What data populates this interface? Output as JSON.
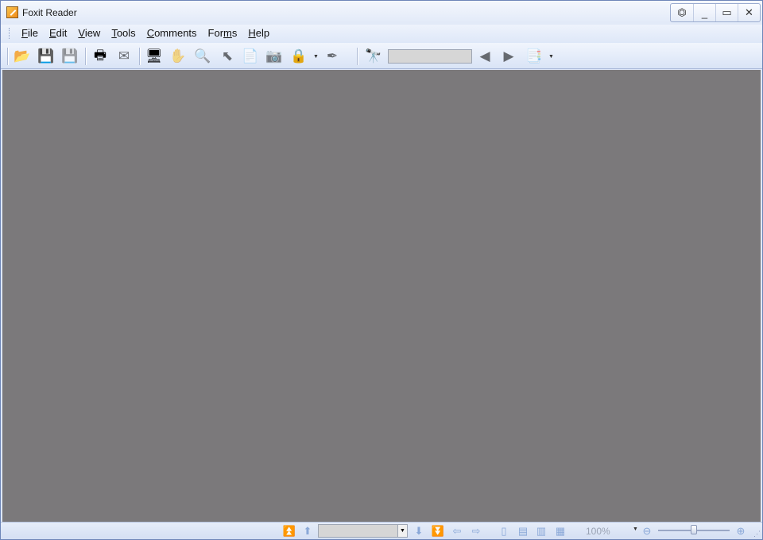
{
  "window": {
    "title": "Foxit Reader"
  },
  "menu": {
    "file": "File",
    "edit": "Edit",
    "view": "View",
    "tools": "Tools",
    "comments": "Comments",
    "forms": "Forms",
    "help": "Help"
  },
  "toolbar": {
    "find_value": ""
  },
  "statusbar": {
    "page_value": "",
    "zoom": "100%",
    "zoom_level": 0.5
  },
  "colors": {
    "document_background": "#7b797b",
    "chrome": "#dde7f8"
  }
}
